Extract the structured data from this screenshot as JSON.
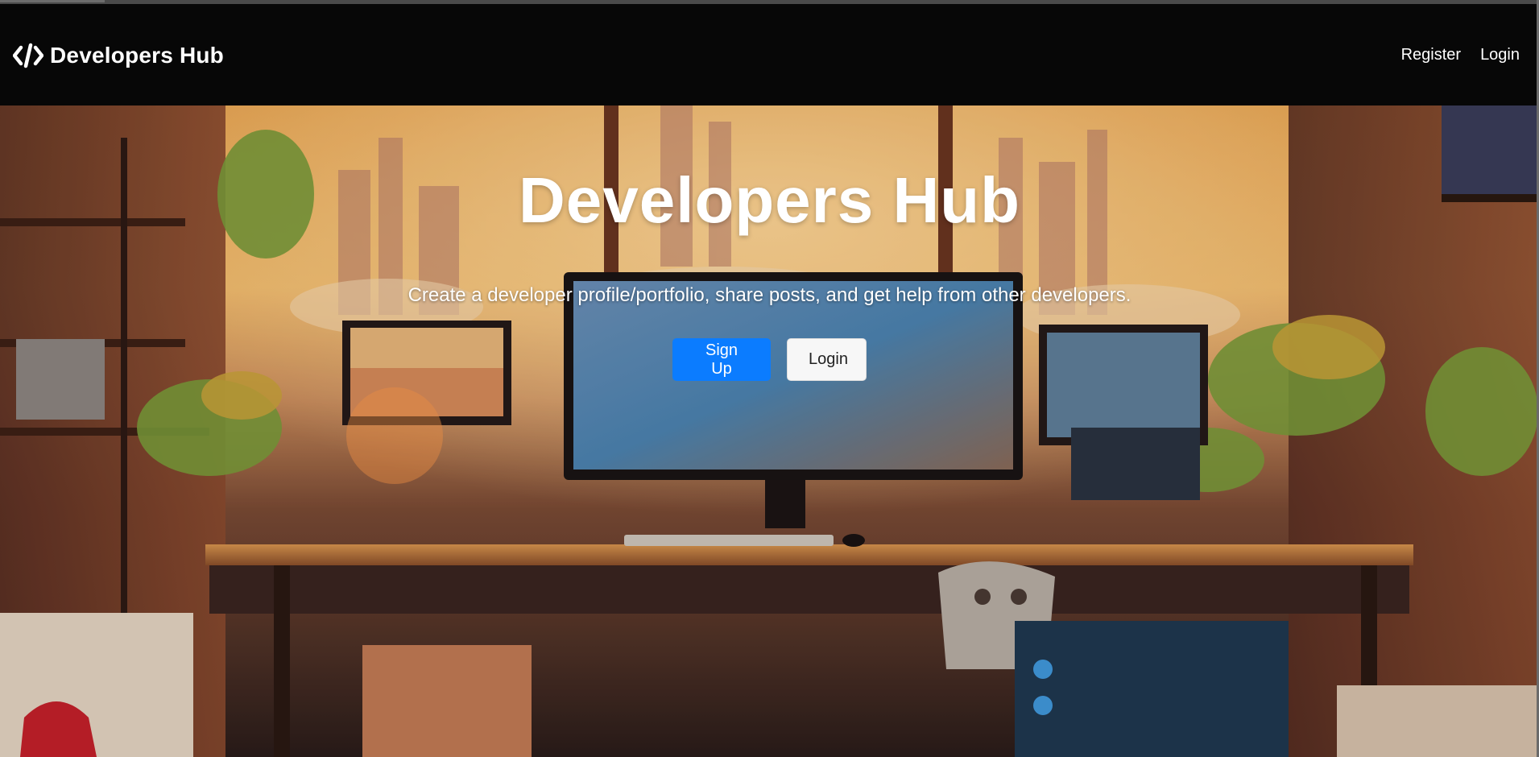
{
  "navbar": {
    "brand_icon": "code-icon",
    "brand_text": "Developers Hub",
    "links": [
      {
        "label": "Register"
      },
      {
        "label": "Login"
      }
    ]
  },
  "hero": {
    "title": "Developers Hub",
    "lead": "Create a developer profile/portfolio, share posts, and get help from other developers.",
    "buttons": {
      "signup_label": "Sign Up",
      "login_label": "Login"
    },
    "background": "illustration of a cozy developer workspace with monitors, plants and city sunset",
    "colors": {
      "primary": "#0b7cff",
      "light": "#f7f7f7",
      "navbar": "#070707"
    }
  }
}
